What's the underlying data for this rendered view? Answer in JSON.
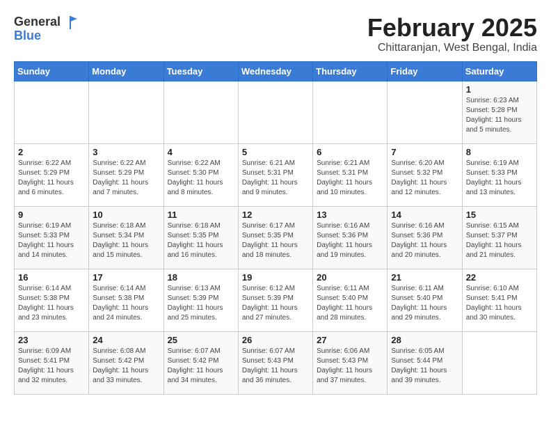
{
  "logo": {
    "general": "General",
    "blue": "Blue"
  },
  "title": "February 2025",
  "location": "Chittaranjan, West Bengal, India",
  "headers": [
    "Sunday",
    "Monday",
    "Tuesday",
    "Wednesday",
    "Thursday",
    "Friday",
    "Saturday"
  ],
  "weeks": [
    [
      {
        "day": "",
        "detail": ""
      },
      {
        "day": "",
        "detail": ""
      },
      {
        "day": "",
        "detail": ""
      },
      {
        "day": "",
        "detail": ""
      },
      {
        "day": "",
        "detail": ""
      },
      {
        "day": "",
        "detail": ""
      },
      {
        "day": "1",
        "detail": "Sunrise: 6:23 AM\nSunset: 5:28 PM\nDaylight: 11 hours and 5 minutes."
      }
    ],
    [
      {
        "day": "2",
        "detail": "Sunrise: 6:22 AM\nSunset: 5:29 PM\nDaylight: 11 hours and 6 minutes."
      },
      {
        "day": "3",
        "detail": "Sunrise: 6:22 AM\nSunset: 5:29 PM\nDaylight: 11 hours and 7 minutes."
      },
      {
        "day": "4",
        "detail": "Sunrise: 6:22 AM\nSunset: 5:30 PM\nDaylight: 11 hours and 8 minutes."
      },
      {
        "day": "5",
        "detail": "Sunrise: 6:21 AM\nSunset: 5:31 PM\nDaylight: 11 hours and 9 minutes."
      },
      {
        "day": "6",
        "detail": "Sunrise: 6:21 AM\nSunset: 5:31 PM\nDaylight: 11 hours and 10 minutes."
      },
      {
        "day": "7",
        "detail": "Sunrise: 6:20 AM\nSunset: 5:32 PM\nDaylight: 11 hours and 12 minutes."
      },
      {
        "day": "8",
        "detail": "Sunrise: 6:19 AM\nSunset: 5:33 PM\nDaylight: 11 hours and 13 minutes."
      }
    ],
    [
      {
        "day": "9",
        "detail": "Sunrise: 6:19 AM\nSunset: 5:33 PM\nDaylight: 11 hours and 14 minutes."
      },
      {
        "day": "10",
        "detail": "Sunrise: 6:18 AM\nSunset: 5:34 PM\nDaylight: 11 hours and 15 minutes."
      },
      {
        "day": "11",
        "detail": "Sunrise: 6:18 AM\nSunset: 5:35 PM\nDaylight: 11 hours and 16 minutes."
      },
      {
        "day": "12",
        "detail": "Sunrise: 6:17 AM\nSunset: 5:35 PM\nDaylight: 11 hours and 18 minutes."
      },
      {
        "day": "13",
        "detail": "Sunrise: 6:16 AM\nSunset: 5:36 PM\nDaylight: 11 hours and 19 minutes."
      },
      {
        "day": "14",
        "detail": "Sunrise: 6:16 AM\nSunset: 5:36 PM\nDaylight: 11 hours and 20 minutes."
      },
      {
        "day": "15",
        "detail": "Sunrise: 6:15 AM\nSunset: 5:37 PM\nDaylight: 11 hours and 21 minutes."
      }
    ],
    [
      {
        "day": "16",
        "detail": "Sunrise: 6:14 AM\nSunset: 5:38 PM\nDaylight: 11 hours and 23 minutes."
      },
      {
        "day": "17",
        "detail": "Sunrise: 6:14 AM\nSunset: 5:38 PM\nDaylight: 11 hours and 24 minutes."
      },
      {
        "day": "18",
        "detail": "Sunrise: 6:13 AM\nSunset: 5:39 PM\nDaylight: 11 hours and 25 minutes."
      },
      {
        "day": "19",
        "detail": "Sunrise: 6:12 AM\nSunset: 5:39 PM\nDaylight: 11 hours and 27 minutes."
      },
      {
        "day": "20",
        "detail": "Sunrise: 6:11 AM\nSunset: 5:40 PM\nDaylight: 11 hours and 28 minutes."
      },
      {
        "day": "21",
        "detail": "Sunrise: 6:11 AM\nSunset: 5:40 PM\nDaylight: 11 hours and 29 minutes."
      },
      {
        "day": "22",
        "detail": "Sunrise: 6:10 AM\nSunset: 5:41 PM\nDaylight: 11 hours and 30 minutes."
      }
    ],
    [
      {
        "day": "23",
        "detail": "Sunrise: 6:09 AM\nSunset: 5:41 PM\nDaylight: 11 hours and 32 minutes."
      },
      {
        "day": "24",
        "detail": "Sunrise: 6:08 AM\nSunset: 5:42 PM\nDaylight: 11 hours and 33 minutes."
      },
      {
        "day": "25",
        "detail": "Sunrise: 6:07 AM\nSunset: 5:42 PM\nDaylight: 11 hours and 34 minutes."
      },
      {
        "day": "26",
        "detail": "Sunrise: 6:07 AM\nSunset: 5:43 PM\nDaylight: 11 hours and 36 minutes."
      },
      {
        "day": "27",
        "detail": "Sunrise: 6:06 AM\nSunset: 5:43 PM\nDaylight: 11 hours and 37 minutes."
      },
      {
        "day": "28",
        "detail": "Sunrise: 6:05 AM\nSunset: 5:44 PM\nDaylight: 11 hours and 39 minutes."
      },
      {
        "day": "",
        "detail": ""
      }
    ]
  ]
}
